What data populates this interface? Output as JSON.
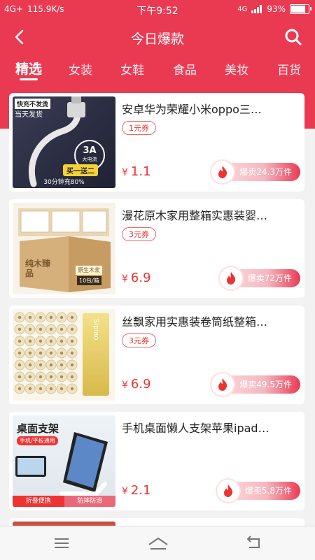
{
  "status_bar": {
    "network": "4G+",
    "speed": "115.9K/s",
    "time": "下午9:52",
    "signal_label": "4G",
    "battery": "93%"
  },
  "header": {
    "title": "今日爆款"
  },
  "tabs": [
    {
      "label": "精选",
      "active": true
    },
    {
      "label": "女装",
      "active": false
    },
    {
      "label": "女鞋",
      "active": false
    },
    {
      "label": "食品",
      "active": false
    },
    {
      "label": "美妆",
      "active": false
    },
    {
      "label": "百货",
      "active": false
    }
  ],
  "products": [
    {
      "title": "安卓华为荣耀小米oppo三…",
      "coupon": "1元券",
      "price": "1.1",
      "sold": "爆卖24.3万件",
      "thumb": {
        "tag1": "快充不发烫",
        "tag2": "当天发货",
        "badge": "3A",
        "badge_sub": "大电流",
        "promo": "买一送二",
        "note": "30分钟充80%"
      }
    },
    {
      "title": "漫花原木家用整箱实惠装婴…",
      "coupon": "3元券",
      "price": "6.9",
      "sold": "爆卖72万件",
      "thumb": {
        "brand": "纯木臻品",
        "label1": "原生木浆",
        "label2": "10包/箱"
      }
    },
    {
      "title": "丝飘家用实惠装卷筒纸整箱…",
      "coupon": "3元券",
      "price": "6.9",
      "sold": "爆卖49.5万件",
      "thumb": {
        "brand": "Sipiao"
      }
    },
    {
      "title": "手机桌面懒人支架苹果ipad…",
      "coupon": "",
      "price": "2.1",
      "sold": "爆卖5.8万件",
      "thumb": {
        "heading": "桌面支架",
        "sub": "手机/平板通用",
        "foot1": "折叠便携",
        "foot2": "防摔防滑"
      }
    }
  ],
  "currency": "¥",
  "colors": {
    "brand": "#ea3a52",
    "price": "#e33333"
  }
}
